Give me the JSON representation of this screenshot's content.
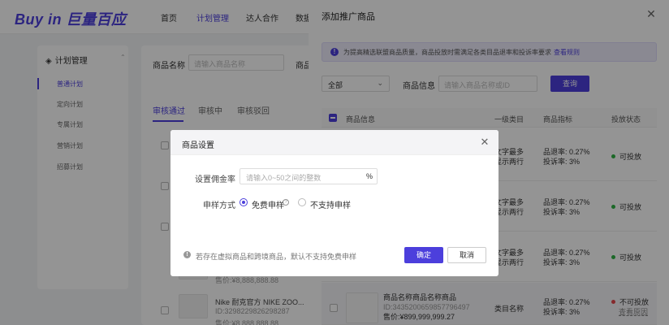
{
  "app": {
    "logo": "Buy in 巨量百应",
    "nav": [
      "首页",
      "计划管理",
      "达人合作",
      "数据"
    ]
  },
  "sidebar": {
    "header": "计划管理",
    "items": [
      "普通计划",
      "定向计划",
      "专属计划",
      "营销计划",
      "招募计划"
    ]
  },
  "main": {
    "filter_product_label": "商品名称",
    "filter_product_placeholder": "请输入商品名称",
    "filter_second_label": "商品",
    "tabs": [
      "审核通过",
      "审核中",
      "审核驳回"
    ],
    "bg_rows": [
      {
        "price": "售价:¥8,888,888.88"
      },
      {
        "name": "Nike 耐克官方 NIKE ZOO...",
        "id": "ID:3298229826298287",
        "price": "售价:¥8,888,888.88"
      }
    ]
  },
  "drawer": {
    "title": "添加推广商品",
    "notice": "为提高精选联盟商品质量，商品投放时需满足各类目品退率和投诉率要求",
    "notice_link": "查看规则",
    "select_value": "全部",
    "search_label": "商品信息",
    "search_placeholder": "请输入商品名称或ID",
    "search_button": "查询",
    "columns": [
      "商品信息",
      "一级类目",
      "商品指标",
      "投放状态"
    ],
    "rows": [
      {
        "category_line1": "文字最多",
        "category_line2": "显示两行",
        "metric1": "品退率: 0.27%",
        "metric2": "投诉率: 3%",
        "status": "可投放",
        "status_color": "#2fb344",
        "status_link": ""
      },
      {
        "category_line1": "文字最多",
        "category_line2": "显示两行",
        "metric1": "品退率: 0.27%",
        "metric2": "投诉率: 3%",
        "status": "可投放",
        "status_color": "#2fb344",
        "status_link": ""
      },
      {
        "category_line1": "文字最多",
        "category_line2": "显示两行",
        "metric1": "品退率: 0.27%",
        "metric2": "投诉率: 3%",
        "status": "可投放",
        "status_color": "#2fb344",
        "status_link": ""
      },
      {
        "name": "商品名称商品名称商品",
        "id": "ID:3435200659857796497",
        "price": "售价:¥899,999,999.27",
        "category_line1": "类目名称",
        "category_line2": "",
        "metric1": "品退率: 0.27%",
        "metric2": "投诉率: 3%",
        "status": "不可投放",
        "status_color": "#e5484d",
        "status_link": "查看原因"
      }
    ]
  },
  "modal": {
    "title": "商品设置",
    "commission_label": "设置佣金率",
    "commission_placeholder": "请输入0~50之间的整数",
    "commission_unit": "%",
    "sample_label": "申样方式",
    "option_free": "免费申样",
    "option_none": "不支持申样",
    "footer_note": "若存在虚拟商品和跨境商品，默认不支持免费申样",
    "ok": "确定",
    "cancel": "取消"
  },
  "colors": {
    "accent": "#4c3fdc",
    "ok": "#2fb344",
    "bad": "#e5484d"
  }
}
